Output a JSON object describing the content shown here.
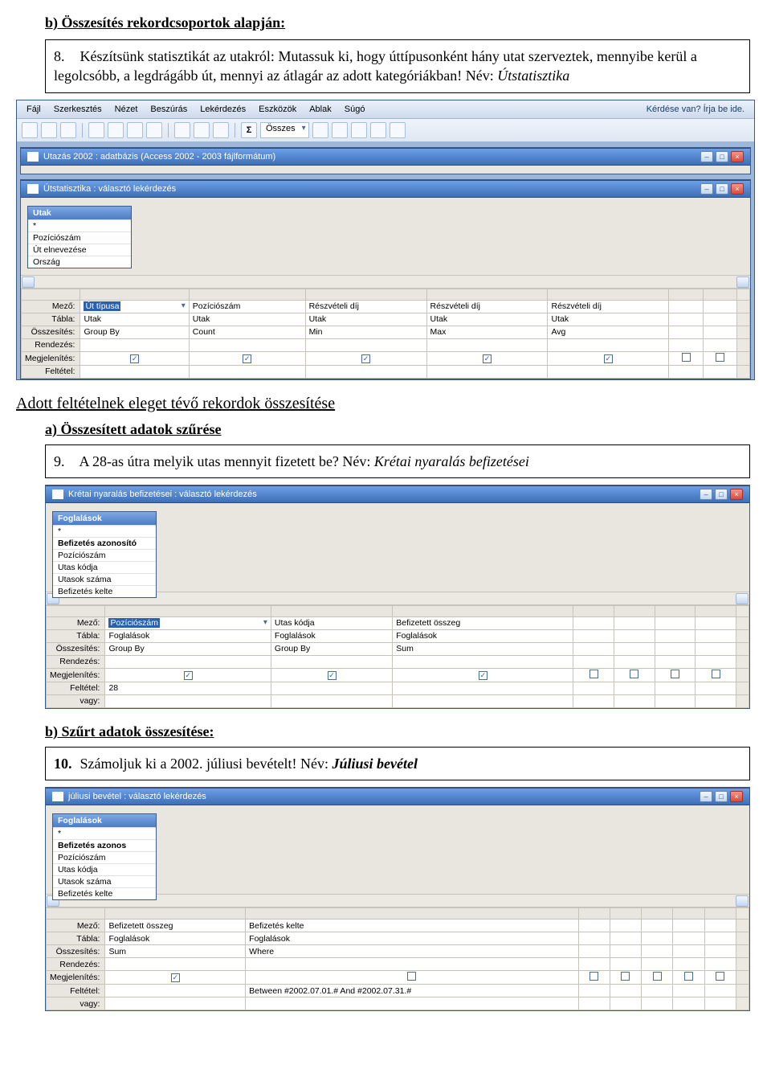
{
  "section_b_title": "b) Összesítés rekordcsoportok alapján:",
  "task8": {
    "num": "8.",
    "text": "Készítsünk statisztikát az utakról: Mutassuk ki, hogy úttípusonként hány utat szerveztek, mennyibe kerül a legolcsóbb, a legdrágább út, mennyi az átlagár az adott kategóriákban! Név: ",
    "name_italic": "Útstatisztika"
  },
  "access1": {
    "menus": [
      "Fájl",
      "Szerkesztés",
      "Nézet",
      "Beszúrás",
      "Lekérdezés",
      "Eszközök",
      "Ablak",
      "Súgó"
    ],
    "help_prompt": "Kérdése van? Írja be ide.",
    "toolbar_dd": "Összes",
    "db_title": "Utazás 2002 : adatbázis (Access 2002 - 2003 fájlformátum)",
    "query_title": "Útstatisztika : választó lekérdezés",
    "table": {
      "name": "Utak",
      "fields": [
        "*",
        "Pozíciószám",
        "Út elnevezése",
        "Ország"
      ]
    },
    "grid": {
      "labels": [
        "Mező:",
        "Tábla:",
        "Összesítés:",
        "Rendezés:",
        "Megjelenítés:",
        "Feltétel:"
      ],
      "cols": [
        {
          "mezo": "Út típusa",
          "tabla": "Utak",
          "ossz": "Group By",
          "megj": true,
          "sel": true,
          "dd": true
        },
        {
          "mezo": "Pozíciószám",
          "tabla": "Utak",
          "ossz": "Count",
          "megj": true
        },
        {
          "mezo": "Részvételi díj",
          "tabla": "Utak",
          "ossz": "Min",
          "megj": true
        },
        {
          "mezo": "Részvételi díj",
          "tabla": "Utak",
          "ossz": "Max",
          "megj": true
        },
        {
          "mezo": "Részvételi díj",
          "tabla": "Utak",
          "ossz": "Avg",
          "megj": true
        },
        {
          "mezo": "",
          "tabla": "",
          "ossz": "",
          "megj": false
        },
        {
          "mezo": "",
          "tabla": "",
          "ossz": "",
          "megj": false
        }
      ]
    }
  },
  "section_mid_title": "Adott feltételnek eleget tévő rekordok összesítése",
  "sub_a": "a) Összesített adatok szűrése",
  "task9": {
    "num": "9.",
    "text": "A 28-as útra melyik utas mennyit fizetett be? Név: ",
    "name_italic": "Krétai nyaralás befizetései"
  },
  "access2": {
    "query_title": "Krétai nyaralás befizetései : választó lekérdezés",
    "table": {
      "name": "Foglalások",
      "fields": [
        "*",
        "Befizetés azonosító",
        "Pozíciószám",
        "Utas kódja",
        "Utasok száma",
        "Befizetés kelte"
      ]
    },
    "grid": {
      "labels": [
        "Mező:",
        "Tábla:",
        "Összesítés:",
        "Rendezés:",
        "Megjelenítés:",
        "Feltétel:",
        "vagy:"
      ],
      "cols": [
        {
          "mezo": "Pozíciószám",
          "tabla": "Foglalások",
          "ossz": "Group By",
          "megj": true,
          "felt": "28",
          "sel": true,
          "dd": true
        },
        {
          "mezo": "Utas kódja",
          "tabla": "Foglalások",
          "ossz": "Group By",
          "megj": true
        },
        {
          "mezo": "Befizetett összeg",
          "tabla": "Foglalások",
          "ossz": "Sum",
          "megj": true
        },
        {
          "mezo": "",
          "tabla": "",
          "ossz": "",
          "megj": false
        },
        {
          "mezo": "",
          "tabla": "",
          "ossz": "",
          "megj": false
        },
        {
          "mezo": "",
          "tabla": "",
          "ossz": "",
          "megj": false
        },
        {
          "mezo": "",
          "tabla": "",
          "ossz": "",
          "megj": false
        }
      ]
    }
  },
  "sub_b2": "b) Szűrt adatok összesítése:",
  "task10": {
    "num": "10.",
    "text": "Számoljuk ki a 2002. júliusi bevételt! Név: ",
    "name_italic": "Júliusi bevétel"
  },
  "access3": {
    "query_title": "júliusi bevétel : választó lekérdezés",
    "table": {
      "name": "Foglalások",
      "fields": [
        "*",
        "Befizetés azonos",
        "Pozíciószám",
        "Utas kódja",
        "Utasok száma",
        "Befizetés kelte"
      ]
    },
    "grid": {
      "labels": [
        "Mező:",
        "Tábla:",
        "Összesítés:",
        "Rendezés:",
        "Megjelenítés:",
        "Feltétel:",
        "vagy:"
      ],
      "cols": [
        {
          "mezo": "Befizetett összeg",
          "tabla": "Foglalások",
          "ossz": "Sum",
          "megj": true
        },
        {
          "mezo": "Befizetés kelte",
          "tabla": "Foglalások",
          "ossz": "Where",
          "megj": false,
          "felt": "Between #2002.07.01.# And #2002.07.31.#"
        },
        {
          "mezo": "",
          "tabla": "",
          "ossz": "",
          "megj": false
        },
        {
          "mezo": "",
          "tabla": "",
          "ossz": "",
          "megj": false
        },
        {
          "mezo": "",
          "tabla": "",
          "ossz": "",
          "megj": false
        },
        {
          "mezo": "",
          "tabla": "",
          "ossz": "",
          "megj": false
        },
        {
          "mezo": "",
          "tabla": "",
          "ossz": "",
          "megj": false
        }
      ]
    }
  }
}
